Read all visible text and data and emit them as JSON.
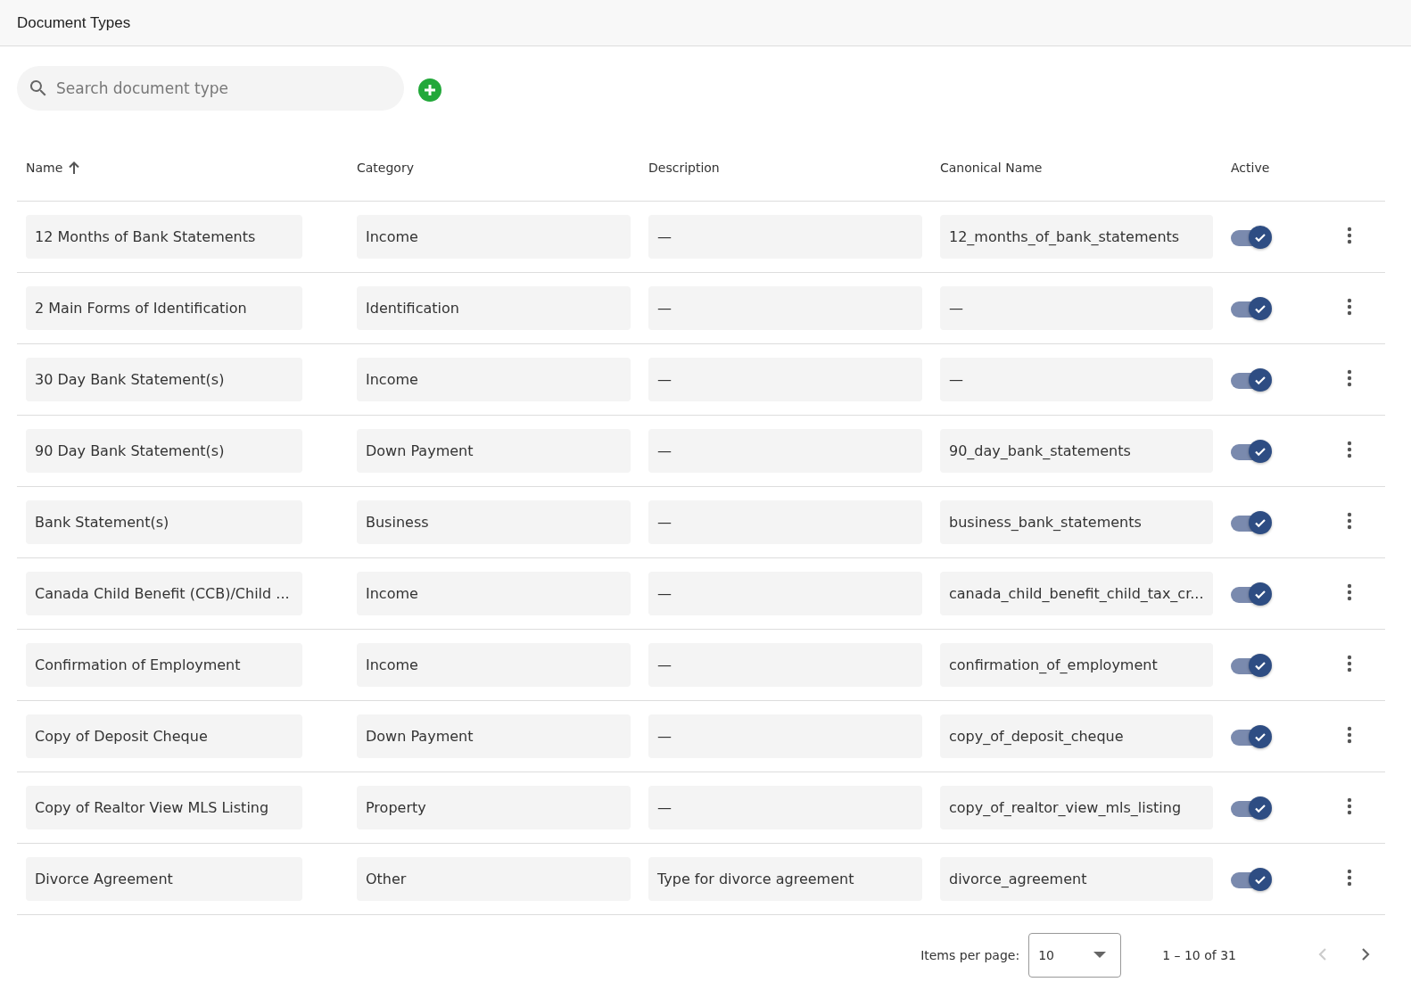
{
  "header": {
    "title": "Document Types"
  },
  "search": {
    "placeholder": "Search document type"
  },
  "table": {
    "columns": [
      {
        "label": "Name",
        "sorted": true
      },
      {
        "label": "Category",
        "sorted": false
      },
      {
        "label": "Description",
        "sorted": false
      },
      {
        "label": "Canonical Name",
        "sorted": false
      },
      {
        "label": "Active",
        "sorted": false
      }
    ],
    "rows": [
      {
        "name": "12 Months of Bank Statements",
        "category": "Income",
        "description": "—",
        "canonical_name": "12_months_of_bank_statements",
        "active": true
      },
      {
        "name": "2 Main Forms of Identification",
        "category": "Identification",
        "description": "—",
        "canonical_name": "—",
        "active": true
      },
      {
        "name": "30 Day Bank Statement(s)",
        "category": "Income",
        "description": "—",
        "canonical_name": "—",
        "active": true
      },
      {
        "name": "90 Day Bank Statement(s)",
        "category": "Down Payment",
        "description": "—",
        "canonical_name": "90_day_bank_statements",
        "active": true
      },
      {
        "name": "Bank Statement(s)",
        "category": "Business",
        "description": "—",
        "canonical_name": "business_bank_statements",
        "active": true
      },
      {
        "name": "Canada Child Benefit (CCB)/Child ...",
        "category": "Income",
        "description": "—",
        "canonical_name": "canada_child_benefit_child_tax_cr...",
        "active": true
      },
      {
        "name": "Confirmation of Employment",
        "category": "Income",
        "description": "—",
        "canonical_name": "confirmation_of_employment",
        "active": true
      },
      {
        "name": "Copy of Deposit Cheque",
        "category": "Down Payment",
        "description": "—",
        "canonical_name": "copy_of_deposit_cheque",
        "active": true
      },
      {
        "name": "Copy of Realtor View MLS Listing",
        "category": "Property",
        "description": "—",
        "canonical_name": "copy_of_realtor_view_mls_listing",
        "active": true
      },
      {
        "name": "Divorce Agreement",
        "category": "Other",
        "description": "Type for divorce agreement",
        "canonical_name": "divorce_agreement",
        "active": true
      }
    ]
  },
  "paginator": {
    "items_per_page_label": "Items per page:",
    "page_size": "10",
    "range": "1 – 10 of 31",
    "previous_disabled": true,
    "next_disabled": false
  }
}
